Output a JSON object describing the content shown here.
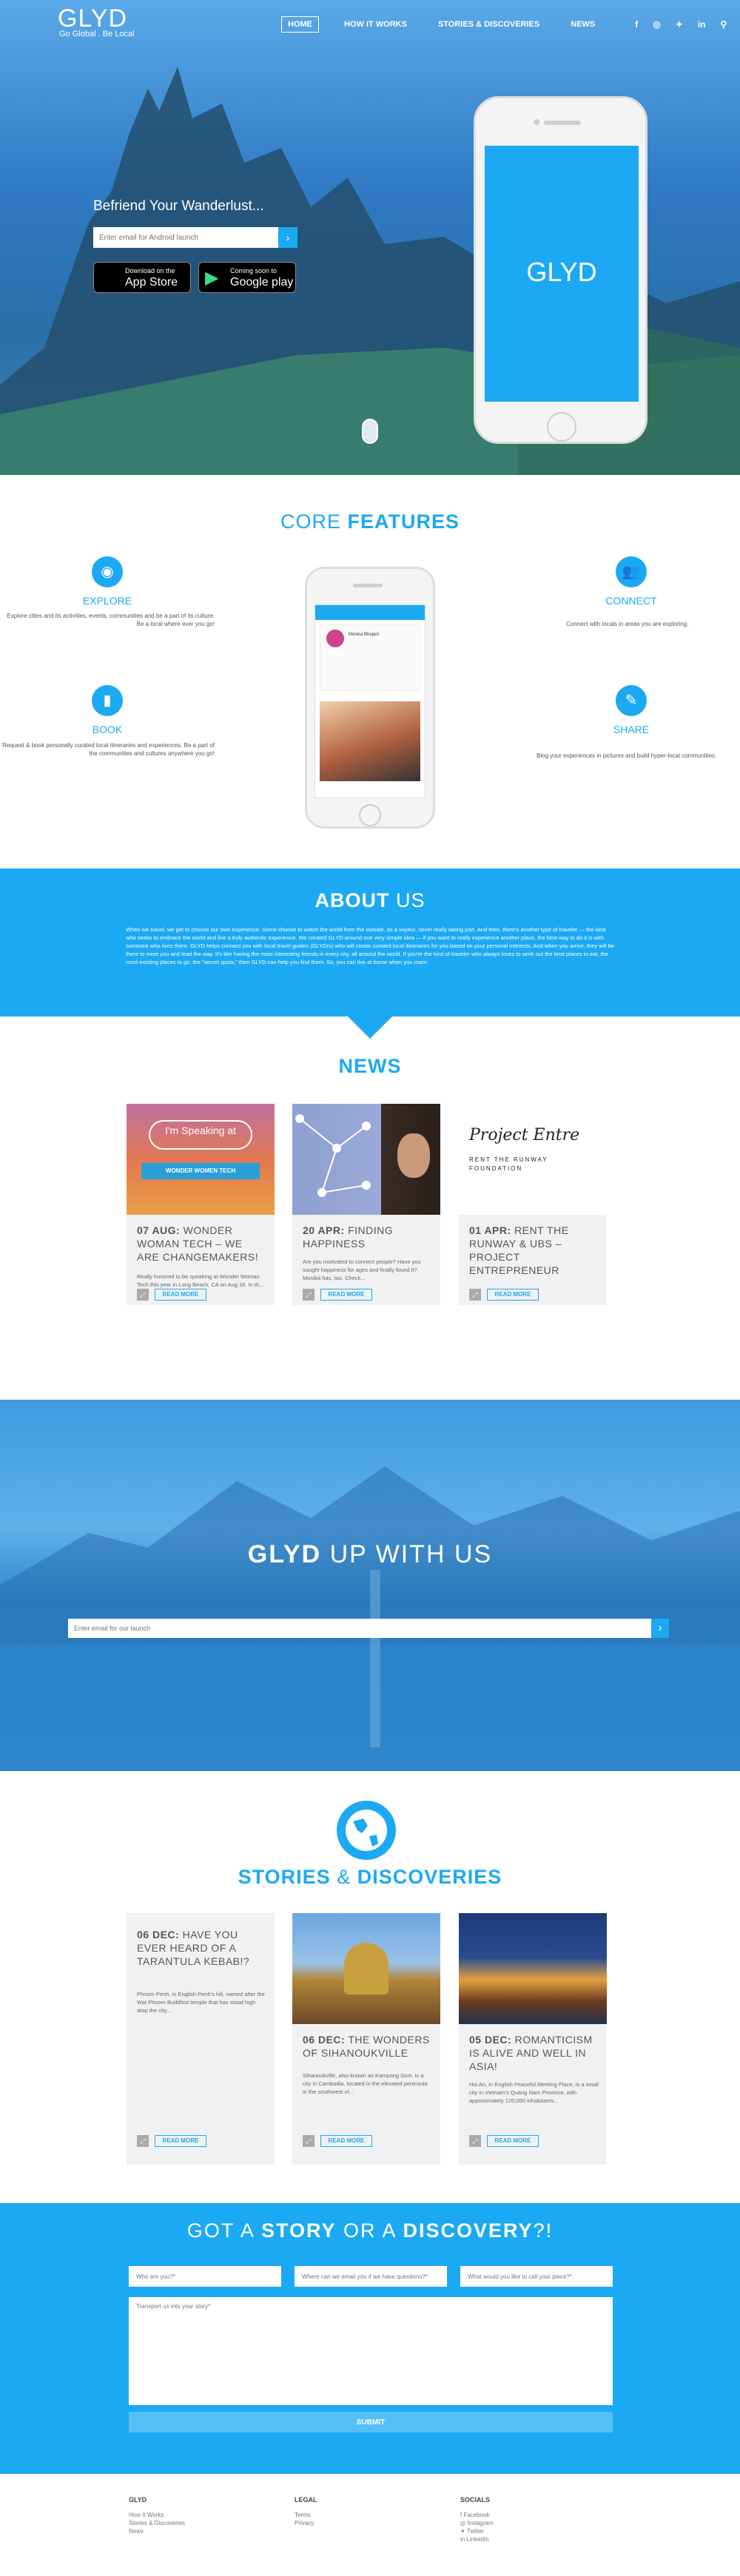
{
  "nav": {
    "logo": "GLYD",
    "tagline": "Go Global . Be Local",
    "items": [
      "HOME",
      "HOW IT WORKS",
      "STORIES & DISCOVERIES",
      "NEWS"
    ],
    "icons": [
      "facebook-icon",
      "instagram-icon",
      "twitter-icon",
      "linkedin-icon",
      "search-icon"
    ]
  },
  "hero": {
    "title": "Befriend Your Wanderlust...",
    "email_placeholder": "Enter email for Android launch",
    "appstore_small": "Download on the",
    "appstore_big": "App Store",
    "googleplay_small": "Coming soon to",
    "googleplay_big": "Google play",
    "phone_label": "GLYD"
  },
  "features": {
    "title_light": "CORE",
    "title_bold": "FEATURES",
    "explore_title": "EXPLORE",
    "explore_desc": "Explore cities and its activities, events, communities and be a part of its culture. Be a local where ever you go!",
    "connect_title": "CONNECT",
    "connect_desc": "Connect with locals in areas you are exploring.",
    "book_title": "BOOK",
    "book_desc": "Request & book personally curated local itineraries and experiences. Be a part of the communities and cultures anywhere you go!",
    "share_title": "SHARE",
    "share_desc": "Blog your experiences in pictures and build hyper-local communities.",
    "phone_profile_name": "Monica Bhojani"
  },
  "about": {
    "title_bold": "ABOUT",
    "title_light": "US",
    "text": "When we travel, we get to choose our own experience. Some choose to watch the world from the outside, as a voyeur, never really taking part. And then, there's another type of traveler — the kind who seeks to embrace the world and live a truly authentic experience. We created GLYD around one very simple idea — if you want to really experience another place, the best way to do it is with someone who lives there. GLYD helps connect you with local travel guides (GLYDrs) who will create curated local itineraries for you based on your personal interests. And when you arrive, they will be there to meet you and lead the way. It's like having the most interesting friends in every city, all around the world. If you're the kind of traveler who always loves to seek out the best places to eat, the most exciting places to go, the \"secret spots,\" then GLYD can help you find them. So, you can live at home when you roam."
  },
  "news": {
    "title": "NEWS",
    "cards": [
      {
        "date": "07 AUG:",
        "title": "WONDER WOMAN TECH – WE ARE CHANGEMAKERS!",
        "excerpt": "Really honored to be speaking at Wonder Woman Tech this year in Long Beach, CA on Aug 16. In th...",
        "img_caption": "I'm Speaking at",
        "img_sub": "WONDER WOMEN TECH"
      },
      {
        "date": "20 APR:",
        "title": "FINDING HAPPINESS",
        "excerpt": "Are you motivated to connect people? Have you sought happiness for ages and finally found it? Monika has, too. Check...",
        "img_caption": "",
        "img_sub": ""
      },
      {
        "date": "01 APR:",
        "title": "RENT THE RUNWAY & UBS – PROJECT ENTREPRENEUR",
        "excerpt": "",
        "img_caption": "Project Entre",
        "img_sub": "RENT THE RUNWAY FOUNDATION"
      }
    ],
    "read_more": "READ MORE"
  },
  "glydup": {
    "title_bold": "GLYD",
    "title_light": "UP WITH US",
    "placeholder": "Enter email for our launch"
  },
  "stories": {
    "title_bold1": "STORIES",
    "amp": "&",
    "title_bold2": "DISCOVERIES",
    "cards": [
      {
        "date": "06 DEC:",
        "title": "HAVE YOU EVER HEARD OF A TARANTULA KEBAB!?",
        "excerpt": "Phnom Penh, in English Penh's hill, named after the Wat Phnom Buddhist temple that has stood high atop the city..."
      },
      {
        "date": "06 DEC:",
        "title": "THE WONDERS OF SIHANOUKVILLE",
        "excerpt": "Sihanoukville, also known as Kampong Som, is a city in Cambodia, located in the elevated peninsula in the southwest of..."
      },
      {
        "date": "05 DEC:",
        "title": "ROMANTICISM IS ALIVE AND WELL IN ASIA!",
        "excerpt": "Hoi An, in English Peaceful Meeting Place, is a small city in Vietnam's Quang Nam Province, with approximately 120,000 inhabitants..."
      }
    ],
    "read_more": "READ MORE"
  },
  "contact": {
    "title_pre": "GOT A",
    "title_b1": "STORY",
    "title_mid": "OR A",
    "title_b2": "DISCOVERY",
    "title_post": "?!",
    "field1": "Who are you?*",
    "field2": "Where can we email you if we have questions?*",
    "field3": "What would you like to call your piece?*",
    "message": "Transport us into your story*",
    "submit": "SUBMIT"
  },
  "footer": {
    "col1_head": "GLYD",
    "col1_links": [
      "How It Works",
      "Stories & Discoveries",
      "News"
    ],
    "col2_head": "LEGAL",
    "col2_links": [
      "Terms",
      "Privacy"
    ],
    "col3_head": "SOCIALS",
    "col3_links": [
      "Facebook",
      "Instagram",
      "Twitter",
      "LinkedIn"
    ]
  },
  "colors": {
    "accent": "#1ca9f3"
  }
}
